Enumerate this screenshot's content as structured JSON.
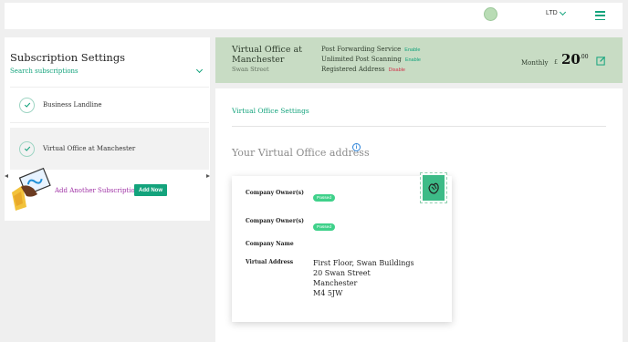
{
  "header": {
    "company_select": "LTD",
    "icons": [
      "avatar",
      "chevron-down-icon",
      "menu-icon"
    ]
  },
  "sidebar": {
    "title": "Subscription Settings",
    "search_label": "Search subscriptions",
    "items": [
      {
        "label": "Business Landline"
      },
      {
        "label": "Virtual Office at Manchester"
      }
    ],
    "add_label": "Add Another Subscription",
    "add_button": "Add Now"
  },
  "banner": {
    "title": "Virtual Office at Manchester",
    "subtitle": "Swan Street",
    "services": [
      {
        "name": "Post Forwarding Service",
        "status": "Enable"
      },
      {
        "name": "Unlimited Post Scanning",
        "status": "Enable"
      },
      {
        "name": "Registered Address",
        "status": "Disable"
      }
    ],
    "billing_period": "Monthly",
    "currency": "£",
    "price": "20",
    "price_cents": ".00"
  },
  "main": {
    "tab": "Virtual Office Settings",
    "address_heading": "Your Virtual Office address",
    "info_icon": "i",
    "card": {
      "rows": [
        {
          "label": "Company Owner(s)",
          "badge": "Passed"
        },
        {
          "label": "Company Owner(s)",
          "badge": "Passed"
        },
        {
          "label": "Company Name"
        },
        {
          "label": "Virtual Address"
        }
      ],
      "address": [
        "First Floor, Swan Buildings",
        "20 Swan Street",
        "Manchester",
        "M4 5JW"
      ]
    }
  },
  "colors": {
    "accent": "#13a37c",
    "banner_bg": "#c8dcc4",
    "disable": "#d2334a",
    "add_link": "#a033a6",
    "passed_badge": "#3fd18a"
  }
}
